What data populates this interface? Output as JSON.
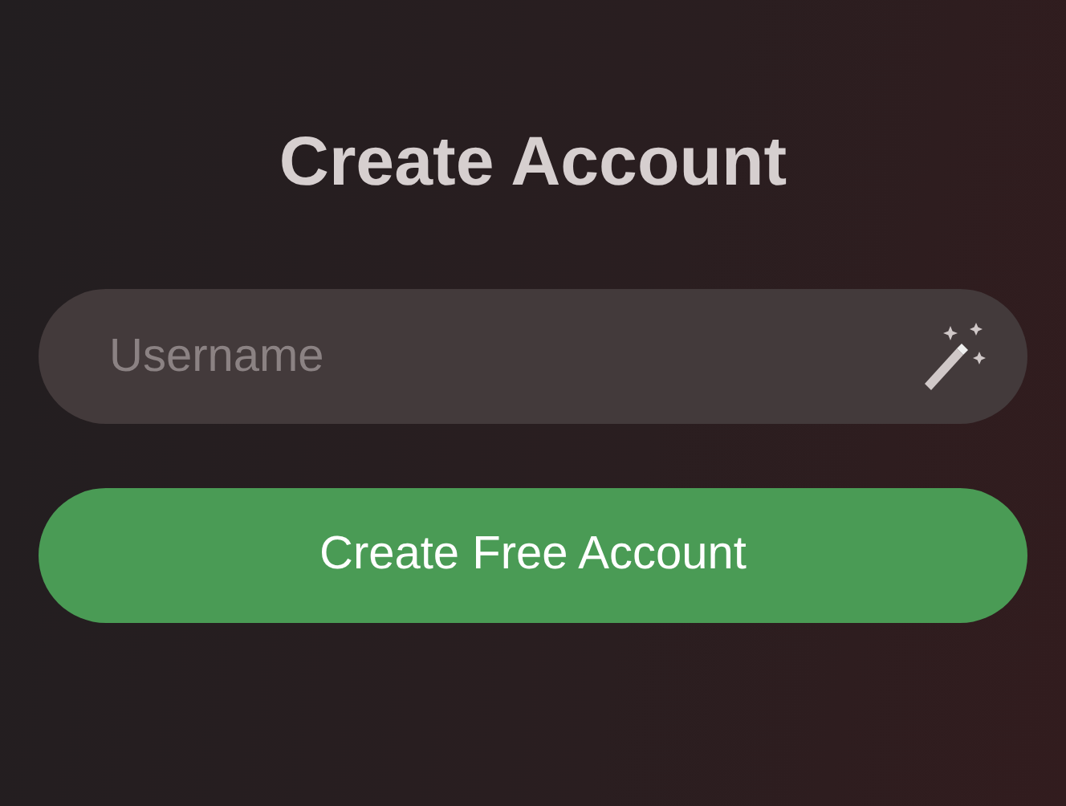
{
  "title": "Create Account",
  "username_field": {
    "placeholder": "Username"
  },
  "submit_button": {
    "label": "Create Free Account"
  }
}
